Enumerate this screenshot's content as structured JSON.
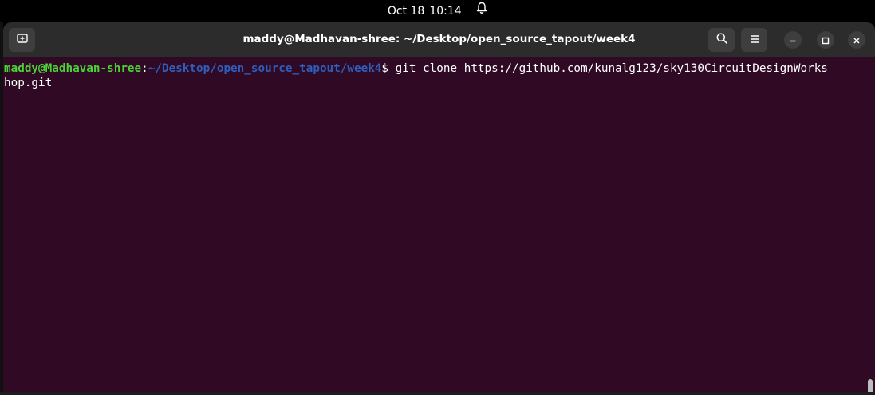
{
  "topbar": {
    "date": "Oct 18",
    "time": "10:14",
    "notification_icon": "bell-icon"
  },
  "window": {
    "title": "maddy@Madhavan-shree: ~/Desktop/open_source_tapout/week4",
    "new_tab_icon": "new-tab-icon",
    "search_icon": "search-icon",
    "menu_icon": "hamburger-menu-icon",
    "minimize_icon": "minimize-icon",
    "maximize_icon": "maximize-icon",
    "close_icon": "close-icon"
  },
  "terminal": {
    "prompt_user": "maddy@Madhavan-shree",
    "prompt_colon": ":",
    "prompt_path": "~/Desktop/open_source_tapout/week4",
    "prompt_symbol": "$ ",
    "command_line1": "git clone https://github.com/kunalg123/sky130CircuitDesignWorks",
    "command_line2": "hop.git"
  },
  "colors": {
    "terminal_bg": "#300a24",
    "prompt_user": "#4ad236",
    "prompt_path": "#2e5fbe",
    "titlebar_bg": "#2c2c2c"
  }
}
